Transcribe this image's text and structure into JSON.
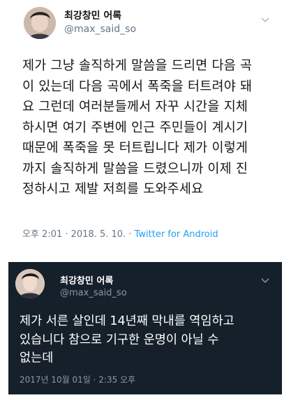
{
  "tweet1": {
    "display_name": "최강창민 어록",
    "handle": "@max_said_so",
    "text": "제가 그냥 솔직하게 말씀을 드리면 다음 곡\n이 있는데 다음 곡에서 폭죽을 터트려야 돼\n요 그런데 여러분들께서 자꾸 시간을 지체\n하시면 여기 주변에 인근 주민들이 계시기\n때문에 폭죽을 못 터트립니다 제가 이렇게\n까지 솔직하게 말씀을 드렸으니까 이제 진\n정하시고 제발 저희를 도와주세요",
    "timestamp": "오후 2:01 · 2018. 5. 10. · ",
    "source": "Twitter for Android",
    "menu_icon": "chevron-down-icon",
    "colors": {
      "background": "#ffffff",
      "text": "#14171a",
      "muted": "#657786",
      "link": "#1da1f2"
    }
  },
  "tweet2": {
    "display_name": "최강창민 어록",
    "handle": "@max_said_so",
    "text": "제가 서른 살인데 14년째 막내를 역임하고\n있습니다 참으로 기구한 운명이 아닐 수\n없는데",
    "timestamp": "2017년 10월 01일 · 2:35 오후",
    "menu_icon": "chevron-down-icon",
    "colors": {
      "background": "#15202b",
      "text": "#ffffff",
      "muted": "#8899a6"
    }
  }
}
